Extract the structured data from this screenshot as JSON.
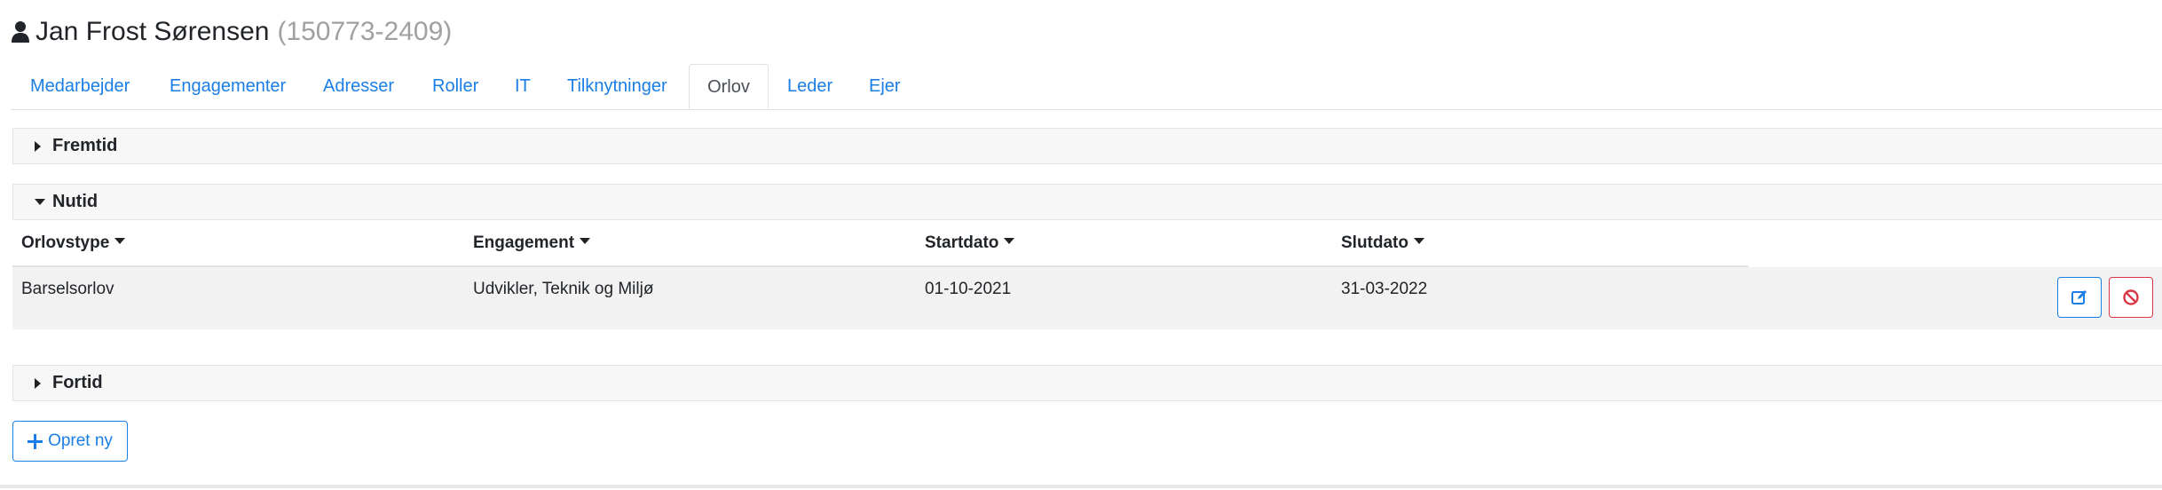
{
  "header": {
    "name": "Jan Frost Sørensen",
    "cpr": "(150773-2409)",
    "icon": "person-icon"
  },
  "tabs": [
    {
      "label": "Medarbejder",
      "active": false
    },
    {
      "label": "Engagementer",
      "active": false
    },
    {
      "label": "Adresser",
      "active": false
    },
    {
      "label": "Roller",
      "active": false
    },
    {
      "label": "IT",
      "active": false
    },
    {
      "label": "Tilknytninger",
      "active": false
    },
    {
      "label": "Orlov",
      "active": true
    },
    {
      "label": "Leder",
      "active": false
    },
    {
      "label": "Ejer",
      "active": false
    }
  ],
  "sections": {
    "future": {
      "title": "Fremtid",
      "expanded": false
    },
    "present": {
      "title": "Nutid",
      "expanded": true
    },
    "past": {
      "title": "Fortid",
      "expanded": false
    }
  },
  "table": {
    "columns": [
      "Orlovstype",
      "Engagement",
      "Startdato",
      "Slutdato"
    ],
    "rows": [
      {
        "orlovstype": "Barselsorlov",
        "engagement": "Udvikler, Teknik og Miljø",
        "startdato": "01-10-2021",
        "slutdato": "31-03-2022"
      }
    ]
  },
  "actions": {
    "edit_icon": "edit-icon",
    "delete_icon": "ban-icon",
    "create_label": "Opret ny",
    "create_icon": "plus-icon"
  },
  "colors": {
    "link": "#1a7ee6",
    "danger": "#dc3545",
    "muted": "#a0a0a0"
  }
}
